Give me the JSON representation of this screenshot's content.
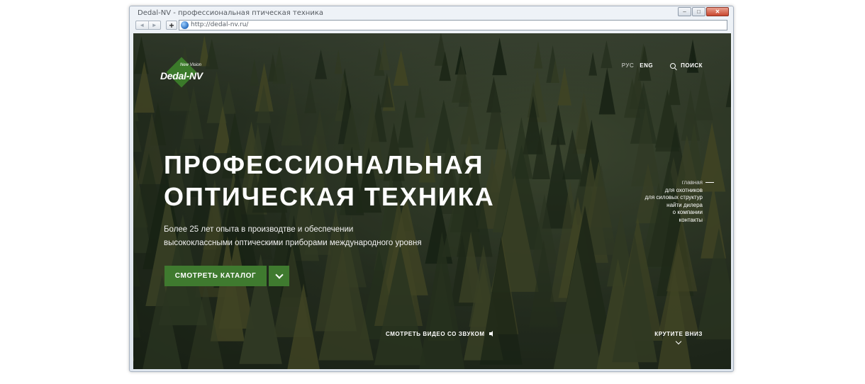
{
  "browser": {
    "window_title": "Dedal-NV - профессиональная птическая техника",
    "url": "http://dedal-nv.ru/",
    "back_label": "◄",
    "forward_label": "►",
    "add_label": "+",
    "minimize_label": "–",
    "maximize_label": "□",
    "close_label": "✕"
  },
  "site": {
    "logo": {
      "name": "Dedal-NV",
      "tagline": "New Vision"
    },
    "languages": [
      {
        "label": "РУС",
        "active": false
      },
      {
        "label": "ENG",
        "active": true
      }
    ],
    "search_label": "ПОИСК",
    "hero": {
      "title_line1": "ПРОФЕССИОНАЛЬНАЯ",
      "title_line2": "ОПТИЧЕСКАЯ ТЕХНИКА",
      "subtitle_line1": "Более 25 лет опыта в производтве и обеспечении",
      "subtitle_line2": "высококлассными оптическими приборами международного уровня",
      "cta_label": "СМОТРЕТЬ КАТАЛОГ"
    },
    "side_nav": [
      {
        "label": "главная",
        "current": true
      },
      {
        "label": "для охотников",
        "current": false
      },
      {
        "label": "для силовых структур",
        "current": false
      },
      {
        "label": "найти дилера",
        "current": false
      },
      {
        "label": "о компании",
        "current": false
      },
      {
        "label": "контакты",
        "current": false
      }
    ],
    "video_link": "СМОТРЕТЬ ВИДЕО СО ЗВУКОМ",
    "scroll_hint": "КРУТИТЕ ВНИЗ",
    "colors": {
      "accent": "#3f7a2f",
      "forest_dark": "#1f2a1c",
      "text": "#ffffff"
    }
  }
}
